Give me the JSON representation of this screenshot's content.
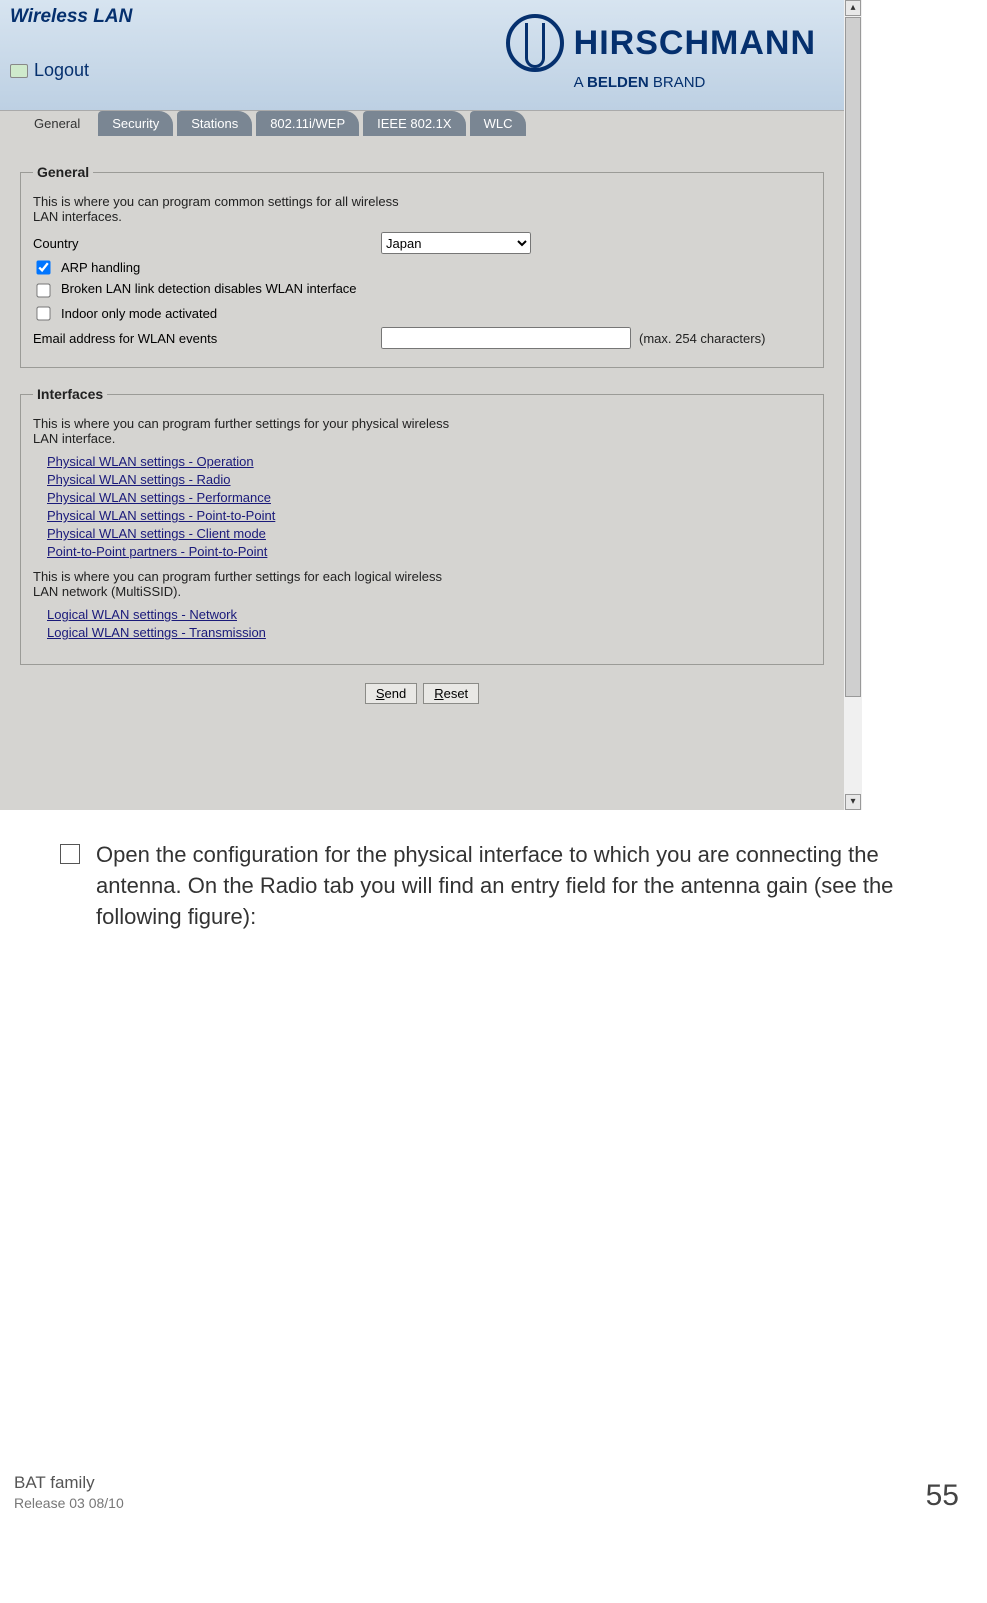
{
  "header": {
    "title": "Wireless LAN",
    "logout_label": "Logout",
    "brand_main": "HIRSCHMANN",
    "brand_sub_a": "A",
    "brand_sub_bold": "BELDEN",
    "brand_sub_brand": "BRAND"
  },
  "tabs": [
    {
      "label": "General",
      "active": true
    },
    {
      "label": "Security",
      "active": false
    },
    {
      "label": "Stations",
      "active": false
    },
    {
      "label": "802.11i/WEP",
      "active": false
    },
    {
      "label": "IEEE 802.1X",
      "active": false
    },
    {
      "label": "WLC",
      "active": false
    }
  ],
  "general": {
    "legend": "General",
    "desc": "This is where you can program common settings for all wireless LAN interfaces.",
    "country_label": "Country",
    "country_value": "Japan",
    "arp_label": "ARP handling",
    "arp_checked": true,
    "broken_label": "Broken LAN link detection disables WLAN interface",
    "broken_checked": false,
    "indoor_label": "Indoor only mode activated",
    "indoor_checked": false,
    "email_label": "Email address for WLAN events",
    "email_value": "",
    "email_hint": "(max. 254 characters)"
  },
  "interfaces": {
    "legend": "Interfaces",
    "desc1": "This is where you can program further settings for your physical wireless LAN interface.",
    "links1": [
      "Physical WLAN settings - Operation",
      "Physical WLAN settings - Radio",
      "Physical WLAN settings - Performance",
      "Physical WLAN settings - Point-to-Point",
      "Physical WLAN settings - Client mode",
      "Point-to-Point partners - Point-to-Point"
    ],
    "desc2": "This is where you can program further settings for each logical wireless LAN network (MultiSSID).",
    "links2": [
      "Logical WLAN settings - Network",
      "Logical WLAN settings - Transmission"
    ]
  },
  "buttons": {
    "send": "Send",
    "reset": "Reset"
  },
  "doc": {
    "step_text": "Open the configuration for the physical interface to which you are connecting the antenna. On the Radio tab you will find an entry field for the antenna gain (see the following figure):",
    "footer_family": "BAT family",
    "footer_release": "Release 03 08/10",
    "page": "55"
  }
}
